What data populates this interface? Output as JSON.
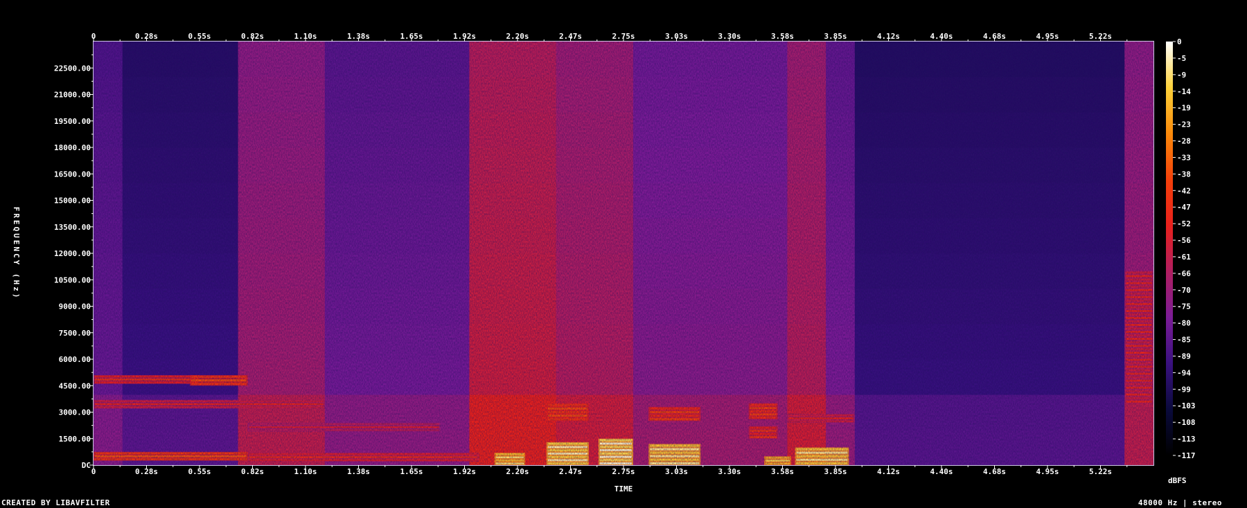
{
  "chart_data": {
    "type": "heatmap",
    "title": "",
    "xlabel": "TIME",
    "ylabel": "FREQUENCY (Hz)",
    "xlim": [
      0,
      5.5
    ],
    "ylim": [
      0,
      24000
    ],
    "x_ticks": [
      "0",
      "0.28s",
      "0.55s",
      "0.82s",
      "1.10s",
      "1.38s",
      "1.65s",
      "1.92s",
      "2.20s",
      "2.47s",
      "2.75s",
      "3.03s",
      "3.30s",
      "3.58s",
      "3.85s",
      "4.12s",
      "4.40s",
      "4.68s",
      "4.95s",
      "5.22s"
    ],
    "y_ticks": [
      "DC",
      "1500.00",
      "3000.00",
      "4500.00",
      "6000.00",
      "7500.00",
      "9000.00",
      "10500.00",
      "12000.00",
      "13500.00",
      "15000.00",
      "16500.00",
      "18000.00",
      "19500.00",
      "21000.00",
      "22500.00"
    ],
    "colorbar": {
      "label": "dBFS",
      "ticks": [
        "0",
        "-5",
        "-9",
        "-14",
        "-19",
        "-23",
        "-28",
        "-33",
        "-38",
        "-42",
        "-47",
        "-52",
        "-56",
        "-61",
        "-66",
        "-70",
        "-75",
        "-80",
        "-85",
        "-89",
        "-94",
        "-99",
        "-103",
        "-108",
        "-113",
        "-117"
      ],
      "range": [
        -120,
        0
      ]
    },
    "colormap": [
      "#000000",
      "#0a0a3c",
      "#3a1180",
      "#7b1c96",
      "#b01e60",
      "#e8201c",
      "#f4400a",
      "#fb8a0a",
      "#fdd23a",
      "#ffffff"
    ],
    "segments": [
      {
        "t": [
          0.0,
          0.15
        ],
        "level": -82
      },
      {
        "t": [
          0.15,
          0.75
        ],
        "level": -92
      },
      {
        "t": [
          0.75,
          1.2
        ],
        "level": -68
      },
      {
        "t": [
          1.2,
          1.95
        ],
        "level": -80
      },
      {
        "t": [
          1.95,
          2.4
        ],
        "level": -58
      },
      {
        "t": [
          2.4,
          2.8
        ],
        "level": -64
      },
      {
        "t": [
          2.8,
          3.6
        ],
        "level": -75
      },
      {
        "t": [
          3.6,
          3.8
        ],
        "level": -63
      },
      {
        "t": [
          3.8,
          3.95
        ],
        "level": -78
      },
      {
        "t": [
          3.95,
          5.35
        ],
        "level": -93
      },
      {
        "t": [
          5.35,
          5.5
        ],
        "level": -68
      }
    ],
    "energy_regions": [
      {
        "t": [
          0.0,
          0.8
        ],
        "f": [
          250,
          750
        ],
        "level": -40
      },
      {
        "t": [
          0.0,
          0.55
        ],
        "f": [
          4600,
          5100
        ],
        "level": -50
      },
      {
        "t": [
          0.5,
          0.8
        ],
        "f": [
          4500,
          5100
        ],
        "level": -42
      },
      {
        "t": [
          0.0,
          1.2
        ],
        "f": [
          3200,
          3700
        ],
        "level": -55
      },
      {
        "t": [
          0.8,
          2.0
        ],
        "f": [
          200,
          700
        ],
        "level": -52
      },
      {
        "t": [
          0.8,
          1.8
        ],
        "f": [
          1900,
          2400
        ],
        "level": -60
      },
      {
        "t": [
          2.08,
          2.24
        ],
        "f": [
          0,
          700
        ],
        "level": -14
      },
      {
        "t": [
          2.35,
          2.57
        ],
        "f": [
          0,
          1300
        ],
        "level": -10
      },
      {
        "t": [
          2.35,
          2.57
        ],
        "f": [
          2500,
          3500
        ],
        "level": -42
      },
      {
        "t": [
          2.62,
          2.8
        ],
        "f": [
          0,
          1500
        ],
        "level": -8
      },
      {
        "t": [
          2.88,
          3.15
        ],
        "f": [
          0,
          1200
        ],
        "level": -12
      },
      {
        "t": [
          2.88,
          3.15
        ],
        "f": [
          2500,
          3300
        ],
        "level": -45
      },
      {
        "t": [
          3.4,
          3.55
        ],
        "f": [
          2600,
          3500
        ],
        "level": -44
      },
      {
        "t": [
          3.4,
          3.55
        ],
        "f": [
          1500,
          2200
        ],
        "level": -48
      },
      {
        "t": [
          3.48,
          3.62
        ],
        "f": [
          0,
          500
        ],
        "level": -16
      },
      {
        "t": [
          3.64,
          3.92
        ],
        "f": [
          0,
          1000
        ],
        "level": -12
      },
      {
        "t": [
          3.6,
          3.95
        ],
        "f": [
          2400,
          2900
        ],
        "level": -55
      },
      {
        "t": [
          5.35,
          5.5
        ],
        "f": [
          3500,
          11000
        ],
        "level": -55
      }
    ]
  },
  "footer": {
    "credit": "CREATED BY LIBAVFILTER",
    "info": "48000 Hz | stereo"
  }
}
